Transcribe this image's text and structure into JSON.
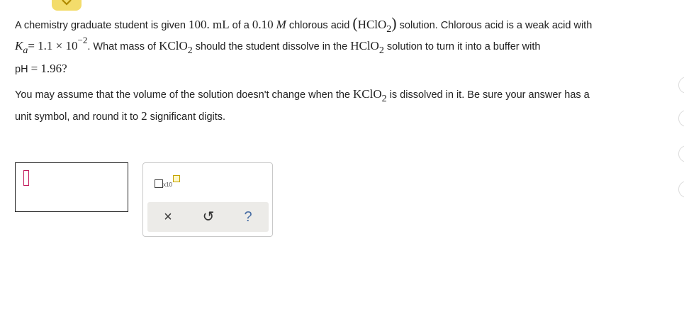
{
  "question": {
    "line1": {
      "t1": "A chemistry graduate student is given ",
      "volume": "100. mL",
      "t2": " of a ",
      "conc": "0.10",
      "conc_unit": "M",
      "t3": " chlorous acid ",
      "acid": "HClO",
      "acid_sub": "2",
      "t4": " solution. Chlorous acid is a weak acid with"
    },
    "line2": {
      "ka_symbol": "K",
      "ka_sub": "a",
      "ka_eq": "= 1.1 × 10",
      "ka_exp": "−2",
      "t1": ". What mass of ",
      "salt": "KClO",
      "salt_sub": "2",
      "t2": " should the student dissolve in the ",
      "acid": "HClO",
      "acid_sub": "2",
      "t3": " solution to turn it into a buffer with"
    },
    "line3": {
      "ph_label": "pH",
      "ph_value": "= 1.96?"
    },
    "line4": {
      "t1": "You may assume that the volume of the solution doesn't change when the ",
      "salt": "KClO",
      "salt_sub": "2",
      "t2": " is dissolved in it. Be sure your answer has a"
    },
    "line5": {
      "t1": "unit symbol, and round it to ",
      "digits": "2",
      "t2": " significant digits."
    }
  },
  "answer": {
    "value": ""
  },
  "toolbar": {
    "x10_label": "x10",
    "clear_symbol": "×",
    "undo_symbol": "↺",
    "help_symbol": "?"
  },
  "colors": {
    "tab": "#f3dc6b",
    "cursor": "#c2185b",
    "toolbar_row": "#ecebe8"
  }
}
